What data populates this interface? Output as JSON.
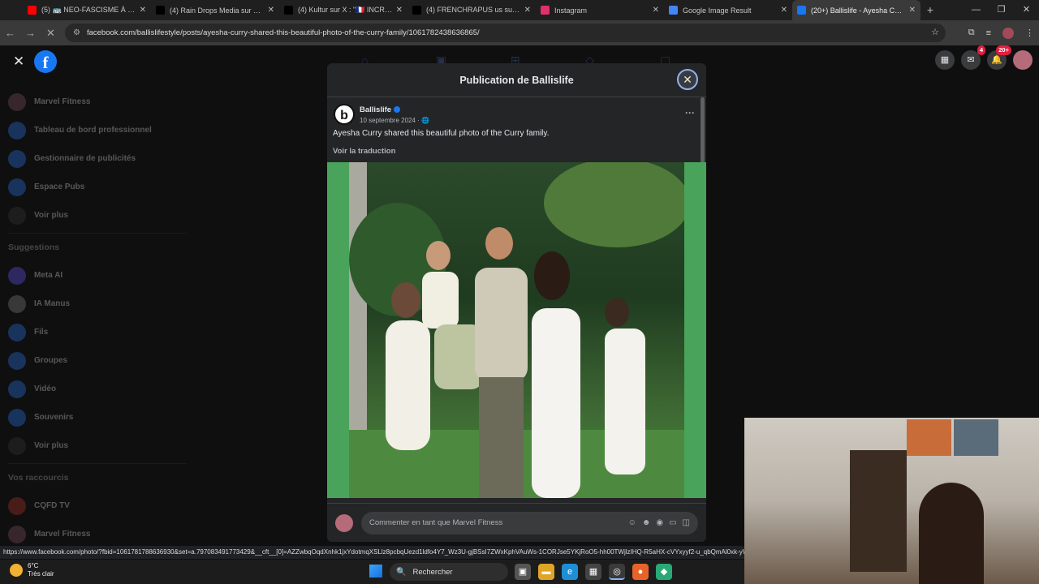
{
  "tabs": [
    {
      "title": "(5) 🚌 NEO-FASCISME À LYON",
      "favicon": "youtube-icon",
      "color": "#ff0000"
    },
    {
      "title": "(4) Rain Drops Media sur X : \"M",
      "favicon": "x-icon",
      "color": "#000000"
    },
    {
      "title": "(4) Kultur sur X : \"🇫🇷 INCROYA",
      "favicon": "x-icon",
      "color": "#000000"
    },
    {
      "title": "(4) FRENCHRAPUS us sur X : \"🇫",
      "favicon": "x-icon",
      "color": "#000000"
    },
    {
      "title": "Instagram",
      "favicon": "instagram-icon",
      "color": "#e1306c"
    },
    {
      "title": "Google Image Result",
      "favicon": "google-icon",
      "color": "#4285f4"
    },
    {
      "title": "(20+) Ballislife - Ayesha Curry s",
      "favicon": "facebook-icon",
      "color": "#1877f2",
      "active": true
    }
  ],
  "address": {
    "url": "facebook.com/ballislifestyle/posts/ayesha-curry-shared-this-beautiful-photo-of-the-curry-family/1061782438636865/"
  },
  "sidebar": {
    "items": [
      {
        "label": "Marvel Fitness",
        "icon": "profile-icon",
        "color": "#8a5a66"
      },
      {
        "label": "Tableau de bord professionnel",
        "icon": "dashboard-icon",
        "color": "#2d7ff9"
      },
      {
        "label": "Gestionnaire de publicités",
        "icon": "ads-icon",
        "color": "#2d7ff9"
      },
      {
        "label": "Espace Pubs",
        "icon": "megaphone-icon",
        "color": "#2d7ff9"
      },
      {
        "label": "Voir plus",
        "icon": "chevron-down-icon",
        "color": "#3a3b3c"
      }
    ],
    "suggestions_title": "Suggestions",
    "suggestions": [
      {
        "label": "Meta AI",
        "icon": "meta-ai-icon",
        "color": "#6b5cff"
      },
      {
        "label": "IA Manus",
        "icon": "robot-icon",
        "color": "#8a8d91"
      },
      {
        "label": "Fils",
        "icon": "feed-icon",
        "color": "#2d7ff9"
      },
      {
        "label": "Groupes",
        "icon": "groups-icon",
        "color": "#2d7ff9"
      },
      {
        "label": "Vidéo",
        "icon": "video-icon",
        "color": "#2d7ff9"
      },
      {
        "label": "Souvenirs",
        "icon": "memories-icon",
        "color": "#2d7ff9"
      },
      {
        "label": "Voir plus",
        "icon": "chevron-down-icon",
        "color": "#3a3b3c"
      }
    ],
    "shortcuts_title": "Vos raccourcis",
    "shortcuts": [
      {
        "label": "CQFD TV",
        "icon": "page-icon",
        "color": "#c0392b"
      },
      {
        "label": "Marvel Fitness",
        "icon": "profile-icon",
        "color": "#8a5a66"
      }
    ]
  },
  "topbar": {
    "messenger_badge": "4",
    "notif_badge": "20+"
  },
  "modal": {
    "title": "Publication de Ballislife",
    "author": "Ballislife",
    "logo_letter": "b",
    "date": "10 septembre 2024 · ",
    "text": "Ayesha Curry shared this beautiful photo of the Curry family.",
    "translate": "Voir la traduction",
    "comment_placeholder": "Commenter en tant que Marvel Fitness"
  },
  "status_url": "https://www.facebook.com/photo/?fbid=1061781788636930&set=a.797083491773429&__cft__[0]=AZZwbqOqdXnhk1jxYdotmqXSLlz8pcbqUezd1ldfo4Y7_Wz3U-gjBSsI7ZWxKphVAuWs-1CORJse5YKjRoO5-hh00TWjlzIHQ-R5aHX-cVYxyyf2-u_qbQmAl0xk-yW39c",
  "taskbar": {
    "temp": "6°C",
    "weather": "Très clair",
    "search_label": "Rechercher"
  }
}
